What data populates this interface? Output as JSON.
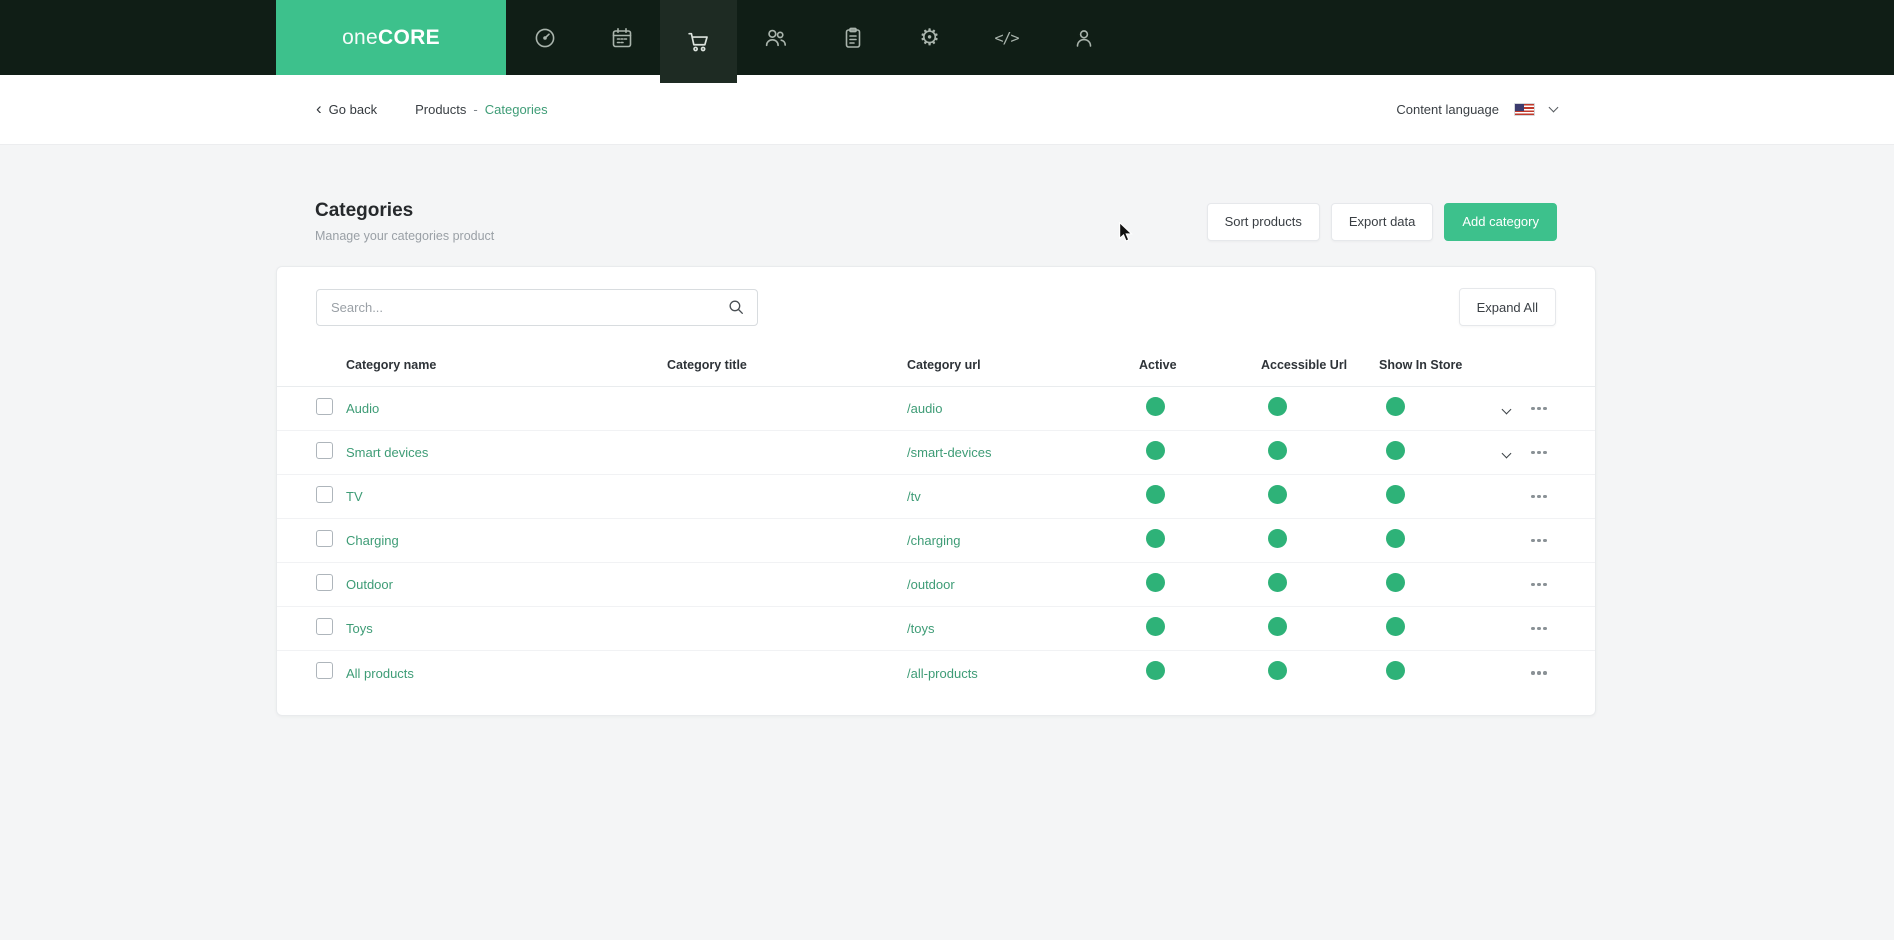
{
  "brand": {
    "prefix": "one",
    "suffix": "CORE"
  },
  "nav": {
    "icons": [
      "dashboard-icon",
      "calendar-icon",
      "cart-icon",
      "users-icon",
      "orders-icon",
      "settings-icon",
      "code-icon",
      "account-icon"
    ],
    "active": "cart-icon"
  },
  "breadcrumb_bar": {
    "go_back": "Go back",
    "parent": "Products",
    "separator": "-",
    "current": "Categories",
    "language_label": "Content language"
  },
  "page": {
    "title": "Categories",
    "subtitle": "Manage your categories product",
    "actions": {
      "sort": "Sort products",
      "export": "Export data",
      "add": "Add category"
    }
  },
  "toolbar": {
    "search_placeholder": "Search...",
    "expand_all": "Expand All"
  },
  "table": {
    "columns": {
      "name": "Category name",
      "title": "Category title",
      "url": "Category url",
      "active": "Active",
      "accessible": "Accessible Url",
      "show": "Show In Store"
    },
    "rows": [
      {
        "name": "Audio",
        "title": "",
        "url": "/audio",
        "active": true,
        "accessible_url": true,
        "show_in_store": true,
        "expandable": true
      },
      {
        "name": "Smart devices",
        "title": "",
        "url": "/smart-devices",
        "active": true,
        "accessible_url": true,
        "show_in_store": true,
        "expandable": true
      },
      {
        "name": "TV",
        "title": "",
        "url": "/tv",
        "active": true,
        "accessible_url": true,
        "show_in_store": true,
        "expandable": false
      },
      {
        "name": "Charging",
        "title": "",
        "url": "/charging",
        "active": true,
        "accessible_url": true,
        "show_in_store": true,
        "expandable": false
      },
      {
        "name": "Outdoor",
        "title": "",
        "url": "/outdoor",
        "active": true,
        "accessible_url": true,
        "show_in_store": true,
        "expandable": false
      },
      {
        "name": "Toys",
        "title": "",
        "url": "/toys",
        "active": true,
        "accessible_url": true,
        "show_in_store": true,
        "expandable": false
      },
      {
        "name": "All products",
        "title": "",
        "url": "/all-products",
        "active": true,
        "accessible_url": true,
        "show_in_store": true,
        "expandable": false
      }
    ]
  },
  "colors": {
    "accent": "#3dc18c",
    "status_dot": "#2eb278",
    "link_green": "#3e9c76",
    "navbar_bg": "#101e16"
  }
}
